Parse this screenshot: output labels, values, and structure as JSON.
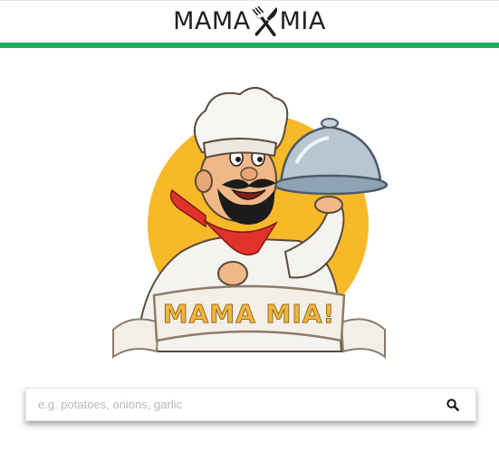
{
  "app": {
    "brand_left": "MAMA",
    "brand_right": "MIA",
    "brand_icon": "fork-knife-crossed-icon"
  },
  "colors": {
    "accent_bar": "#1fae5c",
    "hero_sun": "#f7b928",
    "banner_text": "#f2b53a",
    "banner_ribbon": "#f4efe6",
    "neckerchief": "#e0312a"
  },
  "hero": {
    "banner_text": "MAMA MIA!",
    "image": "chef-mascot-holding-cloche"
  },
  "search": {
    "placeholder": "e.g. potatoes, onions, garlic",
    "value": "",
    "button_icon": "search-icon"
  }
}
